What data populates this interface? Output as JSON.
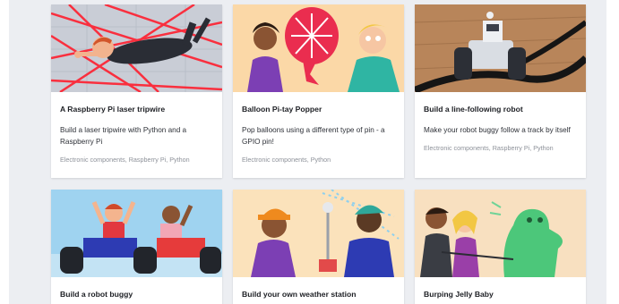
{
  "projects": [
    {
      "title": "A Raspberry Pi laser tripwire",
      "description": "Build a laser tripwire with Python and a Raspberry Pi",
      "tags": "Electronic components, Raspberry Pi, Python",
      "thumb_bg": "#c9cdd6"
    },
    {
      "title": "Balloon Pi-tay Popper",
      "description": "Pop balloons using a different type of pin - a GPIO pin!",
      "tags": "Electronic components, Python",
      "thumb_bg": "#fbd8a7"
    },
    {
      "title": "Build a line-following robot",
      "description": "Make your robot buggy follow a track by itself",
      "tags": "Electronic components, Raspberry Pi, Python",
      "thumb_bg": "#b8855a"
    },
    {
      "title": "Build a robot buggy",
      "thumb_bg": "#9fd3f0"
    },
    {
      "title": "Build your own weather station",
      "thumb_bg": "#fbe2bb"
    },
    {
      "title": "Burping Jelly Baby",
      "thumb_bg": "#f8e0c0"
    }
  ]
}
